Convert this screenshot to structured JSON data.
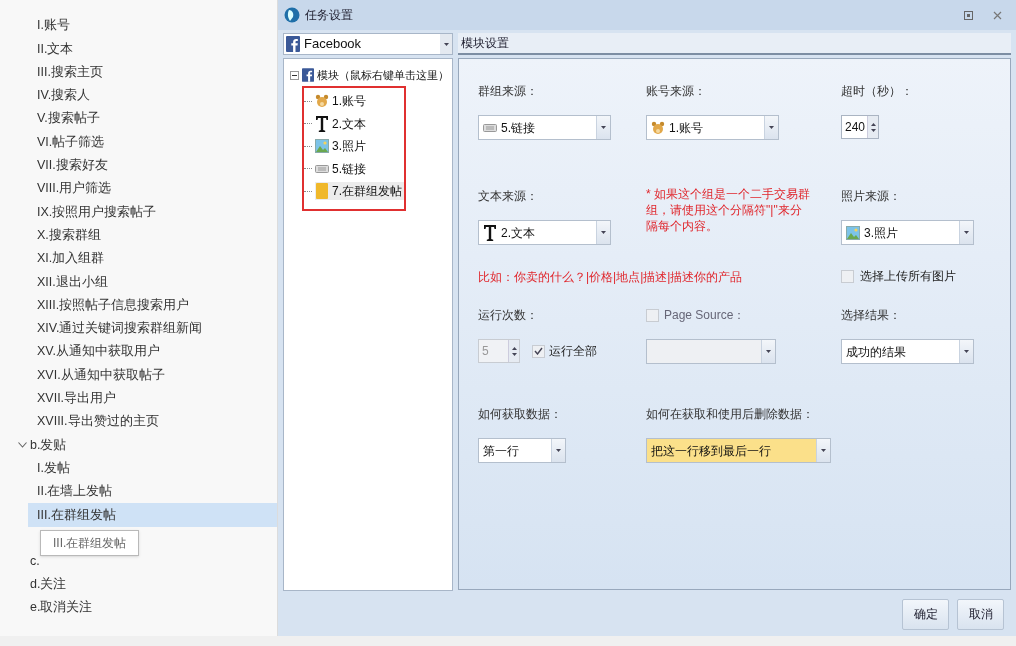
{
  "sidebar": {
    "items": [
      {
        "children": [
          {
            "label": "I.账号",
            "selected": false
          },
          {
            "label": "II.文本",
            "selected": false
          },
          {
            "label": "III.搜索主页",
            "selected": false
          },
          {
            "label": "IV.搜索人",
            "selected": false
          },
          {
            "label": "V.搜索帖子",
            "selected": false
          },
          {
            "label": "VI.帖子筛选",
            "selected": false
          },
          {
            "label": "VII.搜索好友",
            "selected": false
          },
          {
            "label": "VIII.用户筛选",
            "selected": false
          },
          {
            "label": "IX.按照用户搜索帖子",
            "selected": false
          },
          {
            "label": "X.搜索群组",
            "selected": false
          },
          {
            "label": "XI.加入组群",
            "selected": false
          },
          {
            "label": "XII.退出小组",
            "selected": false
          },
          {
            "label": "XIII.按照帖子信息搜索用户",
            "selected": false
          },
          {
            "label": "XIV.通过关键词搜索群组新闻",
            "selected": false
          },
          {
            "label": "XV.从通知中获取用户",
            "selected": false
          },
          {
            "label": "XVI.从通知中获取帖子",
            "selected": false
          },
          {
            "label": "XVII.导出用户",
            "selected": false
          },
          {
            "label": "XVIII.导出赞过的主页",
            "selected": false
          }
        ]
      },
      {
        "label": "b.发贴",
        "selected": false,
        "children": [
          {
            "label": "I.发帖",
            "selected": false
          },
          {
            "label": "II.在墙上发帖",
            "selected": false
          },
          {
            "label": "III.在群组发帖",
            "selected": true
          }
        ]
      },
      {
        "label": "c.",
        "selected": false
      },
      {
        "label": "d.关注",
        "selected": false
      },
      {
        "label": "e.取消关注",
        "selected": false
      }
    ],
    "tooltip": "III.在群组发帖"
  },
  "window": {
    "title": "任务设置"
  },
  "site_select": {
    "value": "Facebook"
  },
  "tree": {
    "label": "模块（鼠标右键单击这里）",
    "expanded": true,
    "children": [
      {
        "label": "1.账号",
        "kind": "account",
        "selected": false
      },
      {
        "label": "2.文本",
        "kind": "text",
        "selected": false
      },
      {
        "label": "3.照片",
        "kind": "photo",
        "selected": false
      },
      {
        "label": "5.链接",
        "kind": "link",
        "selected": false
      },
      {
        "label": "7.在群组发帖",
        "kind": "post",
        "selected": true
      }
    ]
  },
  "panel": {
    "title": "模块设置",
    "rows": [
      [
        {
          "kind": "combo",
          "label": "群组来源：",
          "value": {
            "kind": "link",
            "text": "5.链接"
          },
          "disabled": false,
          "focused": false
        },
        {
          "kind": "combo",
          "label": "账号来源：",
          "value": {
            "kind": "account",
            "text": "1.账号"
          },
          "disabled": false,
          "focused": false
        },
        {
          "kind": "spin",
          "label": "超时（秒）：",
          "value": "240",
          "disabled": false
        }
      ],
      [
        {
          "kind": "combo",
          "label": "文本来源：",
          "value": {
            "kind": "text",
            "text": "2.文本"
          },
          "disabled": false,
          "focused": false
        },
        {
          "kind": "note",
          "text": "* 如果这个组是一个二手交易群组，请使用这个分隔符\"|\"来分隔每个内容。"
        },
        {
          "kind": "combo",
          "label": "照片来源：",
          "value": {
            "kind": "photo",
            "text": "3.照片"
          },
          "disabled": false,
          "focused": false
        }
      ],
      [
        {
          "kind": "note",
          "text": "比如：你卖的什么？|价格|地点|描述|描述你的产品"
        },
        "",
        {
          "kind": "checkbox",
          "label": "选择上传所有图片",
          "checked": false,
          "disabled": true
        }
      ],
      [
        {
          "kind": "spin",
          "label": "运行次数：",
          "value": "5",
          "disabled": true,
          "option": {
            "label": "运行全部",
            "checked": true
          }
        },
        {
          "kind": "combo",
          "label": "Page Source：",
          "label_checked": false,
          "disabled": true,
          "focused": false
        },
        {
          "kind": "combo",
          "label": "选择结果：",
          "value": {
            "text": "成功的结果"
          },
          "disabled": false,
          "focused": false
        }
      ],
      [
        {
          "kind": "combo",
          "label": "如何获取数据：",
          "value": {
            "text": "第一行"
          },
          "disabled": false,
          "focused": false
        },
        {
          "kind": "combo",
          "label": "如何在获取和使用后删除数据：",
          "value": {
            "text": "把这一行移到最后一行"
          },
          "disabled": false,
          "focused": true
        }
      ]
    ]
  },
  "buttons": [
    "确定",
    "取消"
  ]
}
